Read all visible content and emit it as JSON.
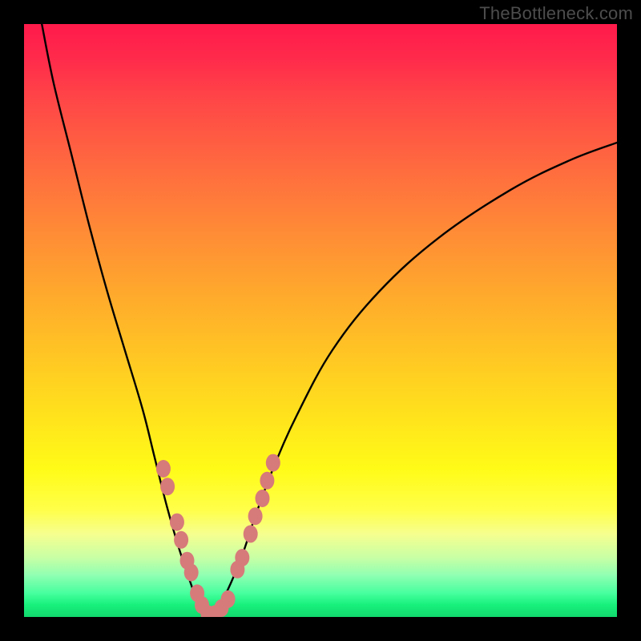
{
  "watermark": "TheBottleneck.com",
  "colors": {
    "frame": "#000000",
    "curve": "#000000",
    "marker": "#d77a7a"
  },
  "chart_data": {
    "type": "line",
    "title": "",
    "xlabel": "",
    "ylabel": "",
    "xlim": [
      0,
      100
    ],
    "ylim": [
      0,
      100
    ],
    "grid": false,
    "legend": null,
    "note": "V-shaped bottleneck curve. x is a normalized component-balance axis; y is bottleneck severity (0 = perfect match at the bottom, 100 = severe at the top). Left branch descends from top-left to the valley near x≈31; right branch rises from the valley toward the upper right.",
    "series": [
      {
        "name": "left-branch",
        "x": [
          3,
          5,
          8,
          11,
          14,
          17,
          20,
          22,
          24,
          26,
          28,
          29.5,
          31
        ],
        "y": [
          100,
          90,
          78,
          66,
          55,
          45,
          35,
          27,
          19,
          12,
          6,
          2,
          0
        ]
      },
      {
        "name": "right-branch",
        "x": [
          31,
          33,
          35,
          37,
          39,
          42,
          46,
          52,
          60,
          70,
          82,
          92,
          100
        ],
        "y": [
          0,
          2,
          6,
          11,
          17,
          25,
          34,
          45,
          55,
          64,
          72,
          77,
          80
        ]
      }
    ],
    "markers": {
      "name": "highlighted-points",
      "note": "Salmon-colored sample dots clustered near the valley on both branches.",
      "points": [
        {
          "x": 23.5,
          "y": 25
        },
        {
          "x": 24.2,
          "y": 22
        },
        {
          "x": 25.8,
          "y": 16
        },
        {
          "x": 26.5,
          "y": 13
        },
        {
          "x": 27.5,
          "y": 9.5
        },
        {
          "x": 28.2,
          "y": 7.5
        },
        {
          "x": 29.2,
          "y": 4
        },
        {
          "x": 30.0,
          "y": 2
        },
        {
          "x": 31.0,
          "y": 0.5
        },
        {
          "x": 32.2,
          "y": 0.5
        },
        {
          "x": 33.3,
          "y": 1.5
        },
        {
          "x": 34.4,
          "y": 3
        },
        {
          "x": 36.0,
          "y": 8
        },
        {
          "x": 36.8,
          "y": 10
        },
        {
          "x": 38.2,
          "y": 14
        },
        {
          "x": 39.0,
          "y": 17
        },
        {
          "x": 40.2,
          "y": 20
        },
        {
          "x": 41.0,
          "y": 23
        },
        {
          "x": 42.0,
          "y": 26
        }
      ]
    }
  }
}
